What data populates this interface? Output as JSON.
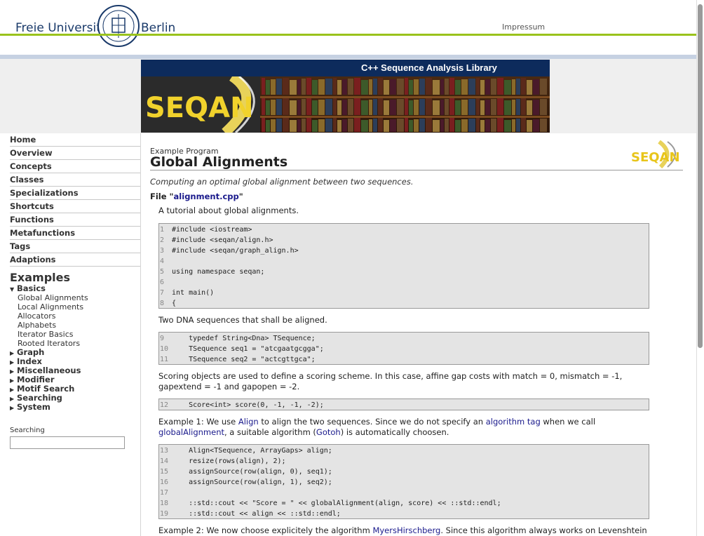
{
  "header": {
    "uni_left": "Freie Universität",
    "uni_right": "Berlin",
    "impressum": "Impressum"
  },
  "banner": {
    "title": "C++ Sequence Analysis Library",
    "logo_text": "SEQAN"
  },
  "sidebar": {
    "nav": [
      "Home",
      "Overview",
      "Concepts",
      "Classes",
      "Specializations",
      "Shortcuts",
      "Functions",
      "Metafunctions",
      "Tags",
      "Adaptions"
    ],
    "examples_heading": "Examples",
    "basics": "Basics",
    "basics_items": [
      "Global Alignments",
      "Local Alignments",
      "Allocators",
      "Alphabets",
      "Iterator Basics",
      "Rooted Iterators"
    ],
    "groups": [
      "Graph",
      "Index",
      "Miscellaneous",
      "Modifier",
      "Motif Search",
      "Searching",
      "System"
    ],
    "search_label": "Searching",
    "search_value": ""
  },
  "main": {
    "kicker": "Example Program",
    "title": "Global Alignments",
    "subtitle": "Computing an optimal global alignment between two sequences.",
    "file_prefix": "File \"",
    "file_name": "alignment.cpp",
    "file_suffix": "\"",
    "p1": "A tutorial about global alignments.",
    "p2": "Two DNA sequences that shall be aligned.",
    "p3": "Scoring objects are used to define a scoring scheme. In this case, affine gap costs with match = 0, mismatch = -1, gapextend = -1 and gapopen = -2.",
    "p4_a": "Example 1: We use ",
    "p4_link1": "Align",
    "p4_b": " to align the two sequences. Since we do not specify an ",
    "p4_link2": "algorithm tag",
    "p4_c": " when we call ",
    "p4_link3": "globalAlignment",
    "p4_d": ", a suitable algorithm (",
    "p4_link4": "Gotoh",
    "p4_e": ") is automatically choosen.",
    "p5_a": "Example 2: We now choose explicitely the algorithm ",
    "p5_link": "MyersHirschberg",
    "p5_b": ". Since this algorithm always works on Levenshtein"
  },
  "code1": [
    [
      "1",
      "#include <iostream>"
    ],
    [
      "2",
      "#include <seqan/align.h>"
    ],
    [
      "3",
      "#include <seqan/graph_align.h>"
    ],
    [
      "4",
      ""
    ],
    [
      "5",
      "using namespace seqan;"
    ],
    [
      "6",
      ""
    ],
    [
      "7",
      "int main()"
    ],
    [
      "8",
      "{"
    ]
  ],
  "code2": [
    [
      "9",
      "    typedef String<Dna> TSequence;"
    ],
    [
      "10",
      "    TSequence seq1 = \"atcgaatgcgga\";"
    ],
    [
      "11",
      "    TSequence seq2 = \"actcgttgca\";"
    ]
  ],
  "code3": [
    [
      "12",
      "    Score<int> score(0, -1, -1, -2);"
    ]
  ],
  "code4": [
    [
      "13",
      "    Align<TSequence, ArrayGaps> align;"
    ],
    [
      "14",
      "    resize(rows(align), 2);"
    ],
    [
      "15",
      "    assignSource(row(align, 0), seq1);"
    ],
    [
      "16",
      "    assignSource(row(align, 1), seq2);"
    ],
    [
      "17",
      ""
    ],
    [
      "18",
      "    ::std::cout << \"Score = \" << globalAlignment(align, score) << ::std::endl;"
    ],
    [
      "19",
      "    ::std::cout << align << ::std::endl;"
    ]
  ]
}
